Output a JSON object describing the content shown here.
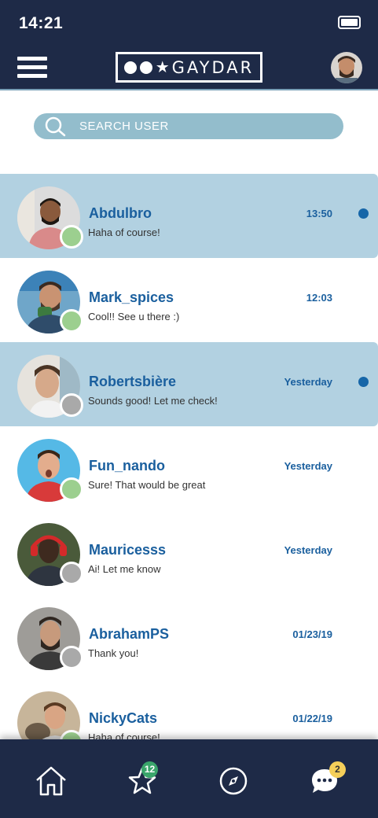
{
  "status_bar": {
    "time": "14:21"
  },
  "header": {
    "logo_text": "GAYDAR"
  },
  "search": {
    "placeholder": "SEARCH USER"
  },
  "conversations": [
    {
      "name": "Abdulbro",
      "message": "Haha of course!",
      "time": "13:50",
      "unread": true,
      "online": true
    },
    {
      "name": "Mark_spices",
      "message": "Cool!! See u there :)",
      "time": "12:03",
      "unread": false,
      "online": true
    },
    {
      "name": "Robertsbière",
      "message": "Sounds good! Let me check!",
      "time": "Yesterday",
      "unread": true,
      "online": false
    },
    {
      "name": "Fun_nando",
      "message": "Sure! That would be great",
      "time": "Yesterday",
      "unread": false,
      "online": true
    },
    {
      "name": "Mauricesss",
      "message": "Ai! Let me know",
      "time": "Yesterday",
      "unread": false,
      "online": false
    },
    {
      "name": "AbrahamPS",
      "message": "Thank you!",
      "time": "01/23/19",
      "unread": false,
      "online": false
    },
    {
      "name": "NickyCats",
      "message": "Haha of course!",
      "time": "01/22/19",
      "unread": false,
      "online": true
    }
  ],
  "tab_bar": {
    "favorites_badge": "12",
    "messages_badge": "2"
  },
  "colors": {
    "navy": "#1e2a47",
    "unread_row": "#b2d1e1",
    "name_blue": "#1a5f9e",
    "online": "#9ccf8f",
    "offline": "#a9a9a9",
    "badge_green": "#3aa56b",
    "badge_yellow": "#f5cf5a"
  }
}
